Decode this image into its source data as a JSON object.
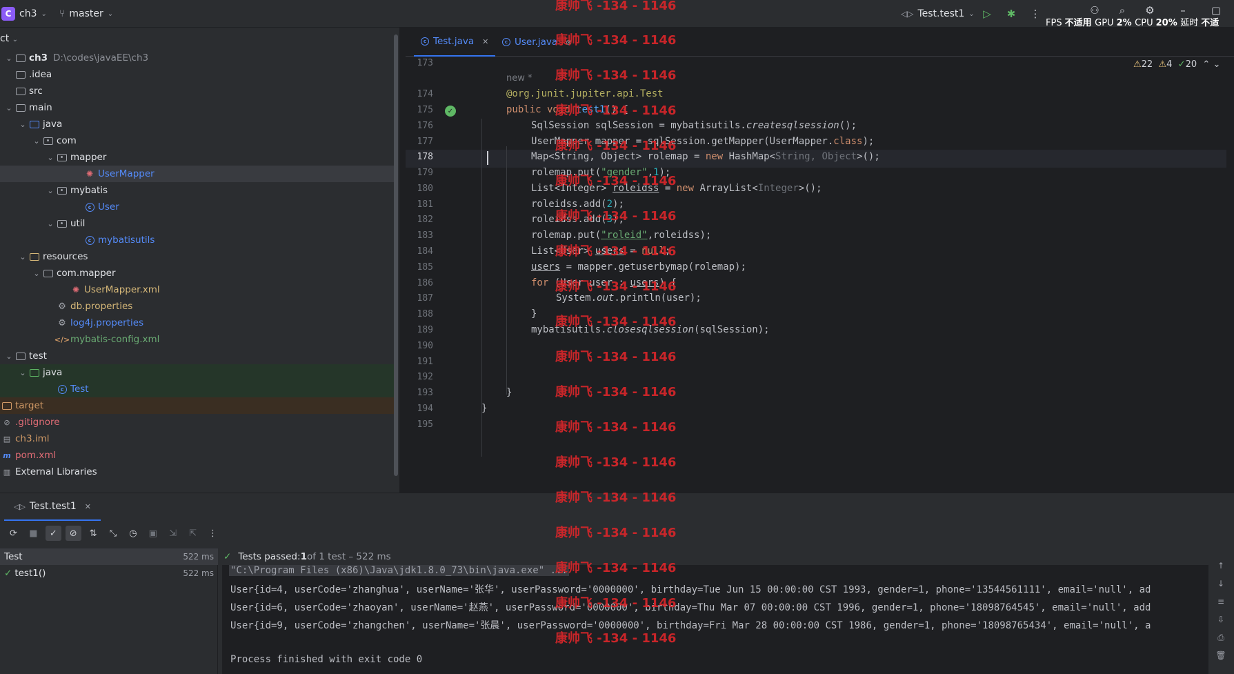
{
  "titlebar": {
    "project_badge": "C",
    "project_name": "ch3",
    "branch": "master",
    "run_config": "Test.test1",
    "perf": {
      "fps_label": "FPS",
      "fps_value": "不适用",
      "gpu_label": "GPU",
      "gpu_value": "2%",
      "cpu_label": "CPU",
      "cpu_value": "20%",
      "latency_label": "延时",
      "latency_value": "不适"
    }
  },
  "project": {
    "header": "ct",
    "tree": [
      {
        "label": "ch3",
        "extra": "D:\\codes\\javaEE\\ch3",
        "icon": "folder",
        "indent": 0,
        "arrow": "open",
        "color": "default"
      },
      {
        "label": ".idea",
        "icon": "folder",
        "indent": 0,
        "arrow": "none",
        "color": "default"
      },
      {
        "label": "src",
        "icon": "folder",
        "indent": 0,
        "arrow": "none",
        "color": "default"
      },
      {
        "label": "main",
        "icon": "folder",
        "indent": 0,
        "arrow": "open",
        "color": "default"
      },
      {
        "label": "java",
        "icon": "folder-blue",
        "indent": 1,
        "arrow": "open",
        "color": "default"
      },
      {
        "label": "com",
        "icon": "package",
        "indent": 2,
        "arrow": "open",
        "color": "default"
      },
      {
        "label": "mapper",
        "icon": "package",
        "indent": 3,
        "arrow": "open",
        "color": "default"
      },
      {
        "label": "UserMapper",
        "icon": "mapper",
        "indent": 5,
        "arrow": "none",
        "color": "blue",
        "selected": true
      },
      {
        "label": "mybatis",
        "icon": "package",
        "indent": 3,
        "arrow": "open",
        "color": "default"
      },
      {
        "label": "User",
        "icon": "class",
        "indent": 5,
        "arrow": "none",
        "color": "blue"
      },
      {
        "label": "util",
        "icon": "package",
        "indent": 3,
        "arrow": "open",
        "color": "default"
      },
      {
        "label": "mybatisutils",
        "icon": "class",
        "indent": 5,
        "arrow": "none",
        "color": "blue"
      },
      {
        "label": "resources",
        "icon": "folder-res",
        "indent": 1,
        "arrow": "open",
        "color": "default"
      },
      {
        "label": "com.mapper",
        "icon": "folder",
        "indent": 2,
        "arrow": "open",
        "color": "default"
      },
      {
        "label": "UserMapper.xml",
        "icon": "mapper",
        "indent": 4,
        "arrow": "none",
        "color": "yellow"
      },
      {
        "label": "db.properties",
        "icon": "gear",
        "indent": 3,
        "arrow": "none",
        "color": "yellow"
      },
      {
        "label": "log4j.properties",
        "icon": "gear",
        "indent": 3,
        "arrow": "none",
        "color": "blue"
      },
      {
        "label": "mybatis-config.xml",
        "icon": "xml",
        "indent": 3,
        "arrow": "none",
        "color": "green"
      },
      {
        "label": "test",
        "icon": "folder",
        "indent": 0,
        "arrow": "open",
        "color": "default"
      },
      {
        "label": "java",
        "icon": "folder-green",
        "indent": 1,
        "arrow": "open",
        "color": "default",
        "band": "green"
      },
      {
        "label": "Test",
        "icon": "class",
        "indent": 3,
        "arrow": "none",
        "color": "blue",
        "band": "green"
      },
      {
        "label": "target",
        "icon": "folder-orange",
        "indent": -1,
        "arrow": "none",
        "color": "orange",
        "band": "orange"
      },
      {
        "label": ".gitignore",
        "icon": "ignore",
        "indent": -1,
        "arrow": "none",
        "color": "red"
      },
      {
        "label": "ch3.iml",
        "icon": "file",
        "indent": -1,
        "arrow": "none",
        "color": "orange"
      },
      {
        "label": "pom.xml",
        "icon": "maven",
        "indent": -1,
        "arrow": "none",
        "color": "red"
      },
      {
        "label": "External Libraries",
        "icon": "lib",
        "indent": -1,
        "arrow": "none",
        "color": "default"
      }
    ]
  },
  "editor": {
    "tabs": [
      {
        "label": "Test.java",
        "active": true
      },
      {
        "label": "User.java",
        "active": false
      }
    ],
    "inspections": {
      "warnings": "22",
      "weak": "4",
      "ok": "20"
    },
    "hint_new": "new *",
    "lines": [
      {
        "n": "173"
      },
      {
        "n": "174"
      },
      {
        "n": "175"
      },
      {
        "n": "176"
      },
      {
        "n": "177"
      },
      {
        "n": "178"
      },
      {
        "n": "179"
      },
      {
        "n": "180"
      },
      {
        "n": "181"
      },
      {
        "n": "182"
      },
      {
        "n": "183"
      },
      {
        "n": "184"
      },
      {
        "n": "185"
      },
      {
        "n": "186"
      },
      {
        "n": "187"
      },
      {
        "n": "188"
      },
      {
        "n": "189"
      },
      {
        "n": "190"
      },
      {
        "n": "191"
      },
      {
        "n": "192"
      },
      {
        "n": "193"
      },
      {
        "n": "194"
      },
      {
        "n": "195"
      }
    ],
    "code": {
      "l174": "@org.junit.jupiter.api.Test",
      "l175_kw": "public void ",
      "l175_fn": "test1",
      "l175_rest": "() {",
      "l176_a": "SqlSession sqlSession = mybatisutils.",
      "l176_b": "createsqlsession",
      "l176_c": "();",
      "l177_a": "UserMapper mapper = sqlSession.getMapper(UserMapper.",
      "l177_b": "class",
      "l177_c": ");",
      "l178_a": "Map<String, Object> rolemap = ",
      "l178_b": "new",
      "l178_c": " HashMap<",
      "l178_d": "String, Object",
      "l178_e": ">();",
      "l179_a": "rolemap.put(",
      "l179_b": "\"gender\"",
      "l179_c": ",",
      "l179_d": "1",
      "l179_e": ");",
      "l180_a": "List<Integer> ",
      "l180_b": "roleidss",
      "l180_c": " = ",
      "l180_d": "new",
      "l180_e": " ArrayList<",
      "l180_f": "Integer",
      "l180_g": ">();",
      "l181_a": "roleidss.add(",
      "l181_b": "2",
      "l181_c": ");",
      "l182_a": "roleidss.add(",
      "l182_b": "3",
      "l182_c": ");",
      "l183_a": "rolemap.put(",
      "l183_b": "\"roleid\"",
      "l183_c": ",roleidss);",
      "l184_a": "List<User> ",
      "l184_b": "users",
      "l184_c": " = ",
      "l184_d": "null",
      "l184_e": ";",
      "l185_a": "users",
      "l185_b": " = mapper.getuserbymap(rolemap);",
      "l186_a": "for",
      "l186_b": " (User user : ",
      "l186_c": "users",
      "l186_d": ") {",
      "l187_a": "System.",
      "l187_b": "out",
      "l187_c": ".println(user);",
      "l188": "}",
      "l189_a": "mybatisutils.",
      "l189_b": "closesqlsession",
      "l189_c": "(sqlSession);",
      "l193": "}",
      "l194": "}"
    }
  },
  "run": {
    "tab_label": "Test.test1",
    "status": {
      "prefix": "Tests passed: ",
      "count": "1",
      "suffix": " of 1 test – 522 ms"
    },
    "tree": [
      {
        "label": "Test",
        "time": "522 ms"
      },
      {
        "label": "test1()",
        "time": "522 ms"
      }
    ],
    "console": [
      "\"C:\\Program Files (x86)\\Java\\jdk1.8.0_73\\bin\\java.exe\" ...",
      "User{id=4, userCode='zhanghua', userName='张华', userPassword='0000000', birthday=Tue Jun 15 00:00:00 CST 1993, gender=1, phone='13544561111', email='null', ad",
      "User{id=6, userCode='zhaoyan', userName='赵燕', userPassword='0000000', birthday=Thu Mar 07 00:00:00 CST 1996, gender=1, phone='18098764545', email='null', add",
      "User{id=9, userCode='zhangchen', userName='张晨', userPassword='0000000', birthday=Fri Mar 28 00:00:00 CST 1986, gender=1, phone='18098765434', email='null', a",
      "",
      "Process finished with exit code 0"
    ]
  },
  "watermark": {
    "text": "康帅飞 -134 - 1146",
    "color": "#d7262a"
  },
  "colors": {
    "accent": "#3574f0",
    "pass": "#5fb865"
  }
}
